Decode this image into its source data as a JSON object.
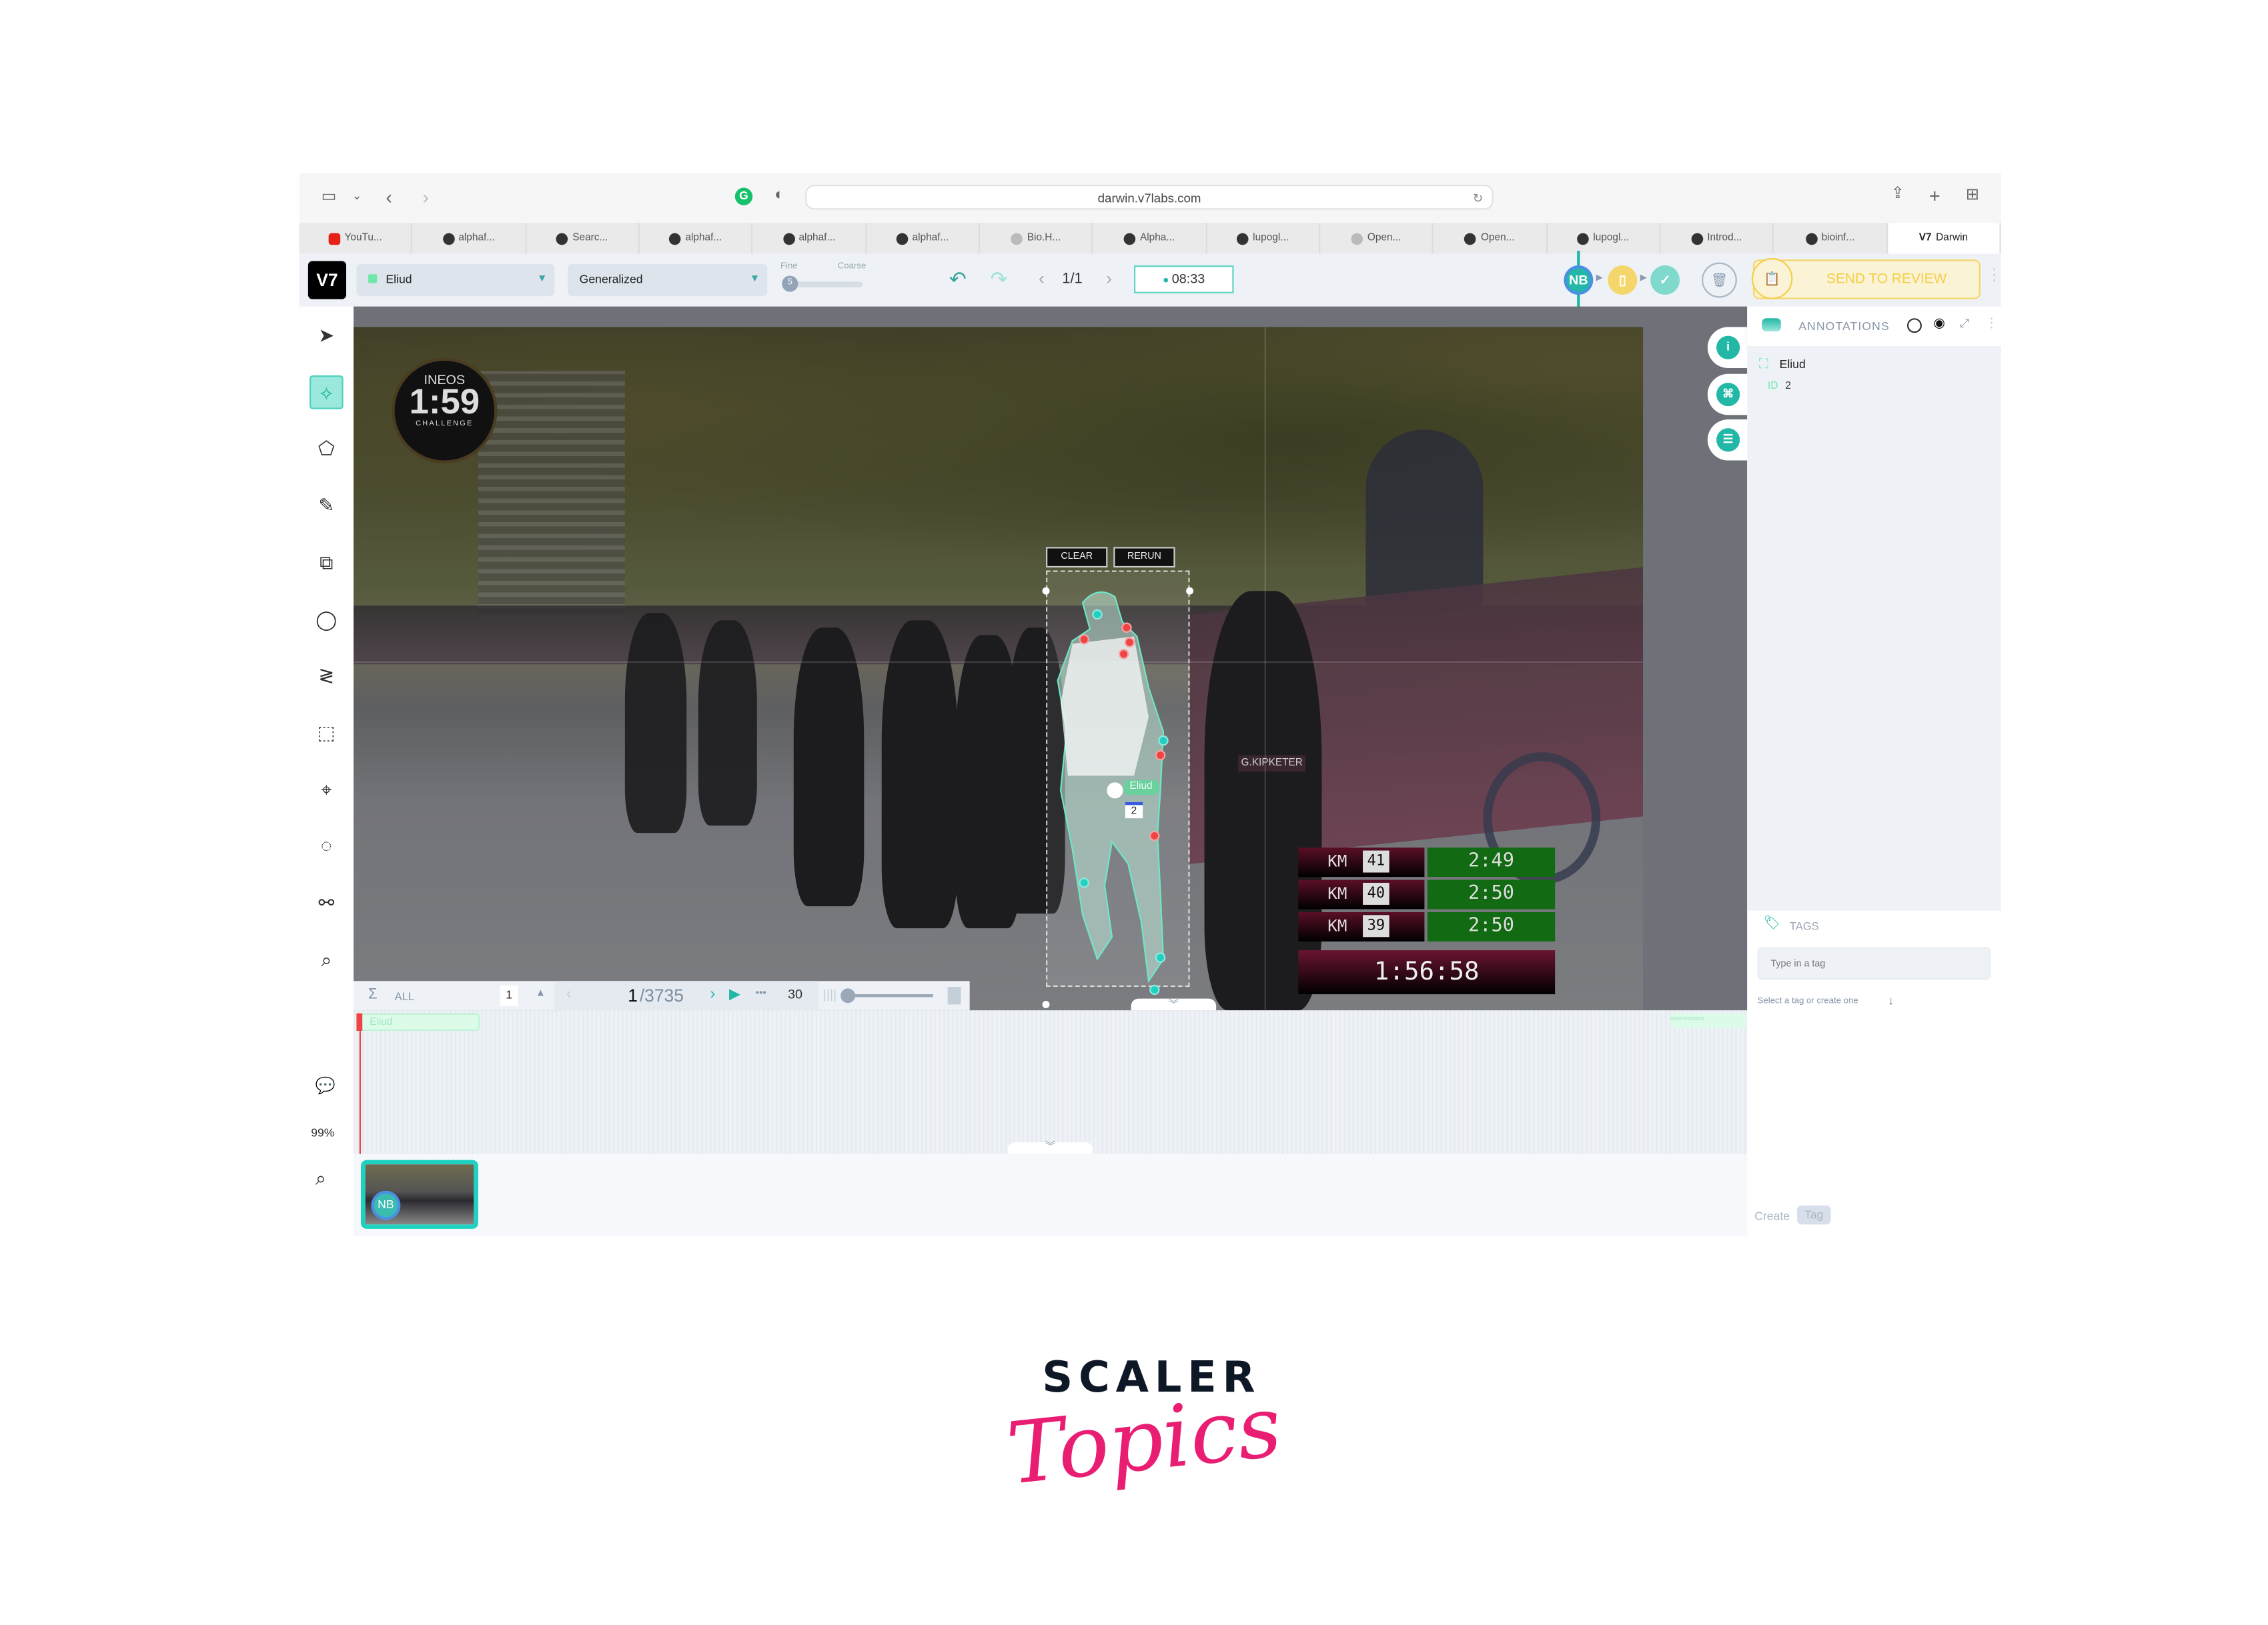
{
  "browser": {
    "url": "darwin.v7labs.com",
    "tabs": [
      {
        "label": "YouTu...",
        "icon": "youtube-icon"
      },
      {
        "label": "alphaf...",
        "icon": "github-icon"
      },
      {
        "label": "Searc...",
        "icon": "github-icon"
      },
      {
        "label": "alphaf...",
        "icon": "github-icon"
      },
      {
        "label": "alphaf...",
        "icon": "github-icon"
      },
      {
        "label": "alphaf...",
        "icon": "github-icon"
      },
      {
        "label": "Bio.H...",
        "icon": "python-icon"
      },
      {
        "label": "Alpha...",
        "icon": "github-icon"
      },
      {
        "label": "lupogl...",
        "icon": "github-icon"
      },
      {
        "label": "Open...",
        "icon": "openai-icon"
      },
      {
        "label": "Open...",
        "icon": "github-icon"
      },
      {
        "label": "lupogl...",
        "icon": "github-icon"
      },
      {
        "label": "Introd...",
        "icon": "page-icon"
      },
      {
        "label": "bioinf...",
        "icon": "github-icon"
      },
      {
        "label": "Darwin",
        "icon": "v7-icon",
        "active": true
      }
    ]
  },
  "toolbar": {
    "logo": "V7",
    "class_select": "Eliud",
    "model_select": "Generalized",
    "fine_label": "Fine",
    "coarse_label": "Coarse",
    "slider_value": "5",
    "page": "1/1",
    "timer": "08:33",
    "assignee_initials": "NB",
    "send_to_review": "SEND TO REVIEW",
    "accent_color": "#22b7a6",
    "review_color": "#f3cf45"
  },
  "left_tools": {
    "items": [
      "select-icon",
      "auto-annotate-icon",
      "polygon-icon",
      "brush-icon",
      "bounding-box-icon",
      "ellipse-icon",
      "polyline-icon",
      "cuboid-icon",
      "keypoint-icon",
      "blob-icon",
      "skeleton-icon",
      "search-icon"
    ],
    "active": "auto-annotate-icon",
    "zoom_level": "99%"
  },
  "canvas": {
    "clear_label": "CLEAR",
    "rerun_label": "RERUN",
    "annotation_label": "Eliud",
    "annotation_id": "2",
    "overlay_logo": {
      "brand": "INEOS",
      "time": "1:59",
      "sub": "CHALLENGE"
    },
    "bib": "G.KIPKETER",
    "scoreboard": {
      "rows": [
        {
          "km": "KM",
          "num": "41",
          "split": "2:49"
        },
        {
          "km": "KM",
          "num": "40",
          "split": "2:50"
        },
        {
          "km": "KM",
          "num": "39",
          "split": "2:50"
        }
      ],
      "total": "1:56:58"
    }
  },
  "right_panel": {
    "title": "ANNOTATIONS",
    "annotations": [
      {
        "name": "Eliud",
        "id_label": "ID",
        "id": "2"
      }
    ],
    "tags_title": "TAGS",
    "tag_placeholder": "Type in a tag",
    "tag_hint": "Select a tag or create one",
    "create_label": "Create",
    "tag_button": "Tag"
  },
  "timeline": {
    "filter": "ALL",
    "layer_count": "1",
    "frame": "1",
    "frame_total": "/3735",
    "fps": "30",
    "track_label": "Eliud",
    "thumb_initials": "NB"
  },
  "branding": {
    "line1": "SCALER",
    "line2": "Topics",
    "color1": "#0d1726",
    "color2": "#e91e73"
  }
}
